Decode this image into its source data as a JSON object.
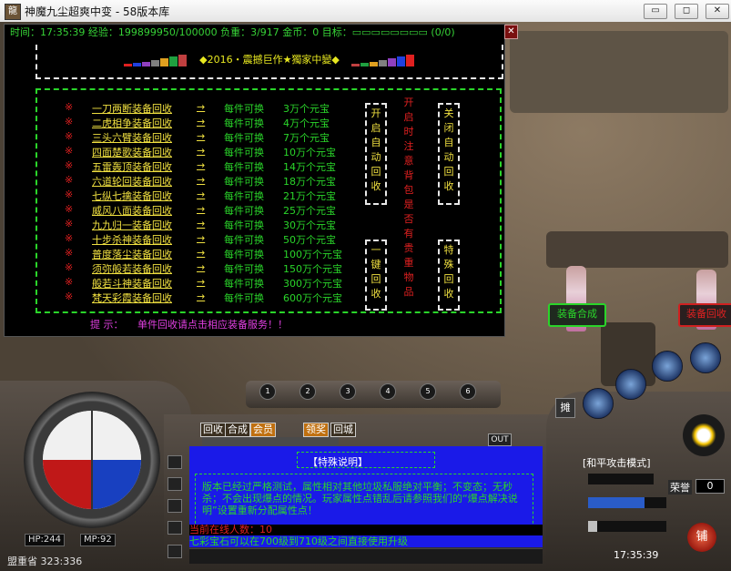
{
  "window": {
    "icon": "app-icon",
    "title": "神魔九尘超爽中变 - 58版本库",
    "buttons": [
      "minimize",
      "maximize",
      "close"
    ],
    "minimize_glyph": "▭",
    "maximize_glyph": "◻",
    "close_glyph": "✕"
  },
  "panel": {
    "stats": "时间：17:35:39  经验：199899950/100000  负重：3/917  金币：0  目标：▭▭▭▭▭▭▭▭ (0/0)",
    "close_glyph": "✕",
    "header": "◆2016・震撼巨作★獨家中變◆",
    "bar_colors_left": [
      "#e02020",
      "#2040e0",
      "#9040c0",
      "#808080",
      "#e0a020",
      "#20a040",
      "#c04040"
    ],
    "bar_colors_right": [
      "#e02020",
      "#2040e0",
      "#9040c0",
      "#808080",
      "#e0a020",
      "#20a040",
      "#c04040"
    ],
    "star_glyph": "※",
    "arrow_glyph": "→",
    "per_label": "每件可换",
    "items": [
      {
        "name": "一刀两断装备回收",
        "price": "3万个元宝"
      },
      {
        "name": "二虎相争装备回收",
        "price": "4万个元宝"
      },
      {
        "name": "三头六臂装备回收",
        "price": "7万个元宝"
      },
      {
        "name": "四面楚歌装备回收",
        "price": "10万个元宝"
      },
      {
        "name": "五雷轰顶装备回收",
        "price": "14万个元宝"
      },
      {
        "name": "六道轮回装备回收",
        "price": "18万个元宝"
      },
      {
        "name": "七纵七擒装备回收",
        "price": "21万个元宝"
      },
      {
        "name": "威风八面装备回收",
        "price": "25万个元宝"
      },
      {
        "name": "九九归一装备回收",
        "price": "30万个元宝"
      },
      {
        "name": "十步杀神装备回收",
        "price": "50万个元宝"
      },
      {
        "name": "普度落尘装备回收",
        "price": "100万个元宝"
      },
      {
        "name": "须弥般若装备回收",
        "price": "150万个元宝"
      },
      {
        "name": "般若斗神装备回收",
        "price": "300万个元宝"
      },
      {
        "name": "梵天彩霞装备回收",
        "price": "600万个元宝"
      }
    ],
    "col_open": [
      "开",
      "启",
      "自",
      "动",
      "回",
      "收"
    ],
    "col_note": [
      "开",
      "启",
      "时",
      "注",
      "意",
      "背",
      "包",
      "是",
      "否",
      "有",
      "贵",
      "重",
      "物",
      "品"
    ],
    "col_close": [
      "关",
      "闭",
      "自",
      "动",
      "回",
      "收"
    ],
    "col_onekey": [
      "一",
      "键",
      "回",
      "收"
    ],
    "col_special": [
      "特",
      "殊",
      "回",
      "收"
    ],
    "tip_label": "提  示：",
    "tip_text": "单件回收请点击相应装备服务！！"
  },
  "npcs": [
    {
      "sign": "装备合成"
    },
    {
      "sign": "装备回收"
    }
  ],
  "hud": {
    "hp": "HP:244",
    "mp": "MP:92",
    "coords": "盟重省 323:336",
    "belt_slots": [
      "1",
      "2",
      "3",
      "4",
      "5",
      "6"
    ],
    "trade_button": "摊",
    "shop_button": "铺",
    "attack_mode": "[和平攻击模式]",
    "honor_label": "荣誉",
    "honor_value": "0",
    "clock": "17:35:39"
  },
  "chat": {
    "tabs": [
      "回收",
      "合成",
      "会员",
      "领奖",
      "回城"
    ],
    "out_button": "OUT",
    "special_title": "【特殊说明】",
    "special_desc": "版本已经过严格测试，属性相对其他垃圾私服绝对平衡；不变态；无秒杀；不会出现爆点的情况。玩家属性点错乱后请参照我们的“爆点解决说明”设置重新分配属性点！",
    "online_line": "当前在线人数：10",
    "gem_line": "七彩宝石可以在700级到710级之间直接使用升级"
  }
}
